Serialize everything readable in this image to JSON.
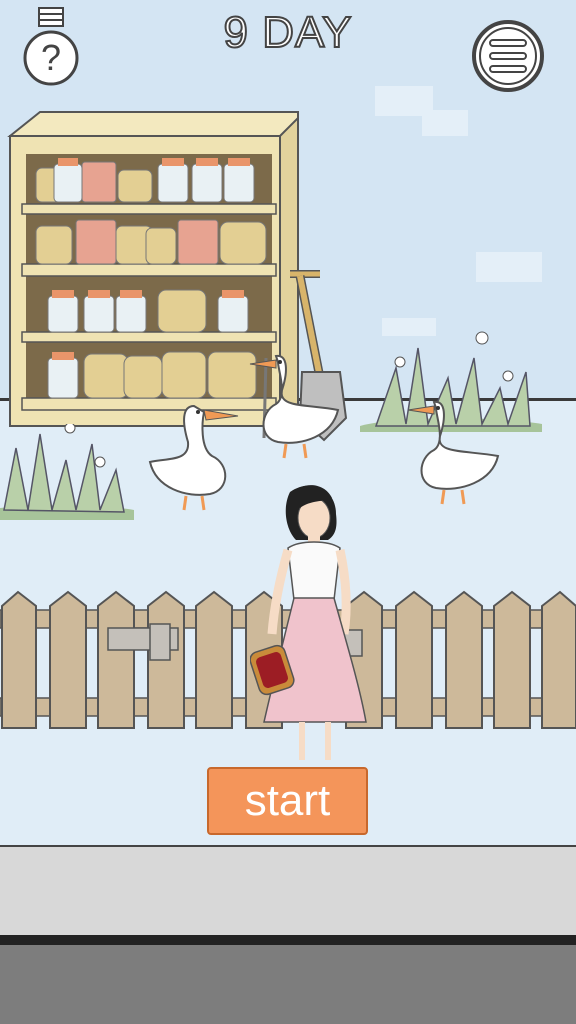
{
  "hud": {
    "day_label": "9 DAY",
    "hint_icon": "lightbulb-question-icon",
    "menu_icon": "hamburger-menu-icon"
  },
  "actions": {
    "start_label": "start"
  },
  "scene": {
    "objects": [
      "storage-shelf",
      "shovel",
      "goose",
      "goose",
      "goose",
      "grass-clump",
      "grass-clump",
      "wooden-fence",
      "woman-character",
      "bread"
    ]
  },
  "colors": {
    "start_button": "#f4955a",
    "sky": "#d4e5f3",
    "ground": "#e0edf7",
    "shelf": "#efe3b3",
    "fence": "#cdb99a"
  }
}
